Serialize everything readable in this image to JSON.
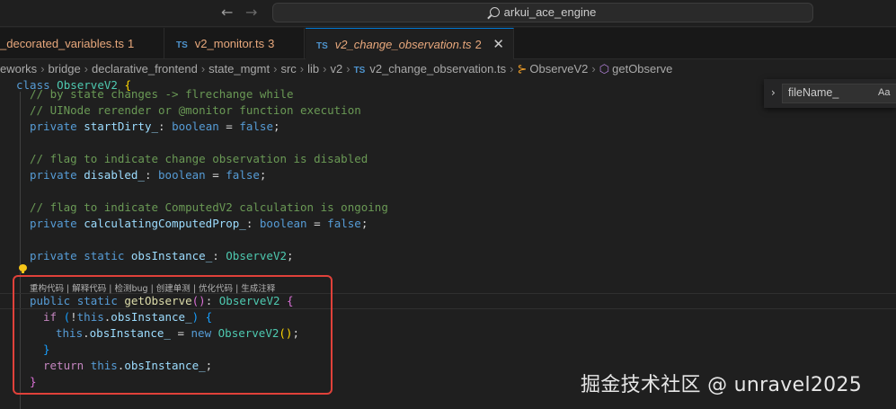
{
  "titlebar": {
    "back_glyph": "←",
    "forward_glyph": "→",
    "search_text": "arkui_ace_engine"
  },
  "tabs": [
    {
      "icon": "TS",
      "name": "_decorated_variables.ts",
      "count": "1"
    },
    {
      "icon": "TS",
      "name": "v2_monitor.ts",
      "count": "3"
    },
    {
      "icon": "TS",
      "name": "v2_change_observation.ts",
      "count": "2",
      "active": true,
      "close_glyph": "✕"
    }
  ],
  "breadcrumb": {
    "segments": [
      "eworks",
      "bridge",
      "declarative_frontend",
      "state_mgmt",
      "src",
      "lib",
      "v2"
    ],
    "file_icon": "TS",
    "file": "v2_change_observation.ts",
    "class_name": "ObserveV2",
    "method_name": "getObserve",
    "separator": "›"
  },
  "editor": {
    "code_lens": "重构代码 | 解释代码 | 检测bug | 创建单测 | 优化代码 | 生成注释",
    "lines": {
      "class_kw": "class",
      "class_name": "ObserveV2",
      "cmt_partial": "// by state changes -> flrechange while",
      "cmt_ui": "// UINode rerender or @monitor function execution",
      "private": "private",
      "public": "public",
      "static": "static",
      "boolean": "boolean",
      "false": "false",
      "start_dirty": "startDirty_",
      "cmt_disabled": "// flag to indicate change observation is disabled",
      "disabled": "disabled_",
      "cmt_computed": "// flag to indicate ComputedV2 calculation is ongoing",
      "calculating": "calculatingComputedProp_",
      "obs_instance": "obsInstance_",
      "get_observe": "getObserve",
      "if_kw": "if",
      "this_kw": "this",
      "new_kw": "new",
      "return_kw": "return"
    }
  },
  "find": {
    "chevron": "›",
    "value": "fileName_",
    "match_case": "Aa"
  },
  "watermark": "掘金技术社区 @ unravel2025"
}
